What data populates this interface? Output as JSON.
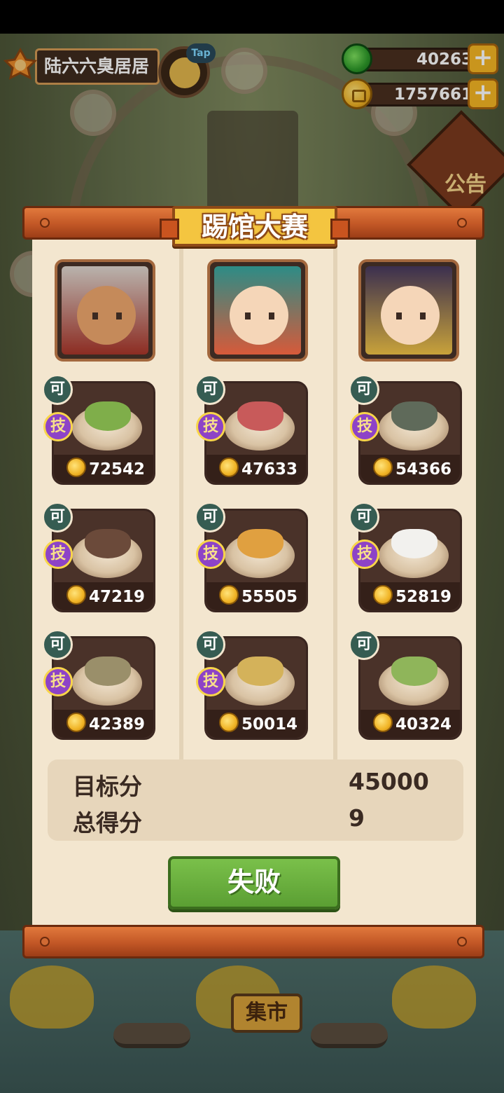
{
  "hud": {
    "player_name": "陆六六臭居居",
    "tap_label": "Tap",
    "jade_amount": "40263",
    "coin_amount": "1757661",
    "plus": "+"
  },
  "background": {
    "notice_label": "公告",
    "market_label": "集市"
  },
  "modal": {
    "title": "踢馆大赛",
    "badge_available": "可",
    "badge_skill": "技",
    "columns": [
      {
        "opponent": "portrait-white-haired",
        "dishes": [
          {
            "price": "72542",
            "skill": true
          },
          {
            "price": "47219",
            "skill": true
          },
          {
            "price": "42389",
            "skill": true
          }
        ]
      },
      {
        "opponent": "portrait-red-haired",
        "dishes": [
          {
            "price": "47633",
            "skill": true
          },
          {
            "price": "55505",
            "skill": true
          },
          {
            "price": "50014",
            "skill": true
          }
        ]
      },
      {
        "opponent": "portrait-qing-official",
        "dishes": [
          {
            "price": "54366",
            "skill": true
          },
          {
            "price": "52819",
            "skill": true
          },
          {
            "price": "40324",
            "skill": false
          }
        ]
      }
    ],
    "target_label": "目标分",
    "target_value": "45000",
    "total_label": "总得分",
    "total_value": "9",
    "result_button": "失败"
  },
  "colors": {
    "title_plate": "#f4c540",
    "paper": "#f3e6cf",
    "fail_button": "#5b9f33",
    "skill_badge": "#8d43c7"
  }
}
